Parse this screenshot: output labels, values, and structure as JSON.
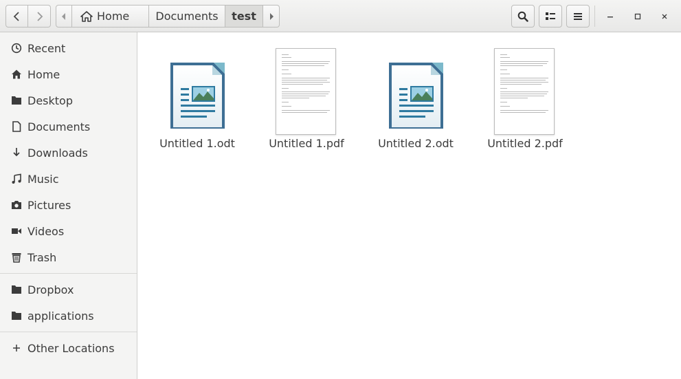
{
  "headerbar": {
    "back_label": "Back",
    "forward_label": "Forward",
    "path": [
      {
        "label": "Home",
        "icon": "home-icon"
      },
      {
        "label": "Documents"
      },
      {
        "label": "test",
        "active": true
      }
    ],
    "icons": {
      "search": "search-icon",
      "view": "list-view-icon",
      "menu": "hamburger-menu-icon",
      "minimize": "minimize-icon",
      "maximize": "maximize-icon",
      "close": "close-icon"
    }
  },
  "sidebar": {
    "items": [
      {
        "label": "Recent",
        "icon": "clock-icon"
      },
      {
        "label": "Home",
        "icon": "home-icon"
      },
      {
        "label": "Desktop",
        "icon": "folder-icon"
      },
      {
        "label": "Documents",
        "icon": "document-icon"
      },
      {
        "label": "Downloads",
        "icon": "download-icon"
      },
      {
        "label": "Music",
        "icon": "music-icon"
      },
      {
        "label": "Pictures",
        "icon": "camera-icon"
      },
      {
        "label": "Videos",
        "icon": "video-icon"
      },
      {
        "label": "Trash",
        "icon": "trash-icon"
      },
      {
        "label": "Dropbox",
        "icon": "folder-icon"
      },
      {
        "label": "applications",
        "icon": "folder-icon"
      },
      {
        "label": "Other Locations",
        "icon": "plus-icon"
      }
    ]
  },
  "files": [
    {
      "name": "Untitled 1.odt",
      "type": "odt"
    },
    {
      "name": "Untitled 1.pdf",
      "type": "pdf"
    },
    {
      "name": "Untitled 2.odt",
      "type": "odt"
    },
    {
      "name": "Untitled 2.pdf",
      "type": "pdf"
    }
  ],
  "colors": {
    "odt_blue": "#2e6d9a",
    "odt_teal": "#6fb6c8",
    "sidebar_bg": "#f4f4f3",
    "text": "#3c3c3c"
  }
}
